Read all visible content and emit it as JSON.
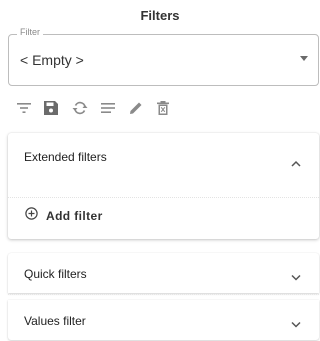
{
  "title": "Filters",
  "filter": {
    "legend": "Filter",
    "value": "< Empty >"
  },
  "toolbar": {
    "icons": [
      "filter-list-icon",
      "save-icon",
      "refresh-icon",
      "notes-icon",
      "edit-icon",
      "delete-icon"
    ]
  },
  "extended": {
    "header": "Extended filters",
    "add_filter_label": "Add filter"
  },
  "sections": [
    {
      "label": "Quick filters"
    },
    {
      "label": "Values filter"
    }
  ],
  "colors": {
    "icon": "#8a8a8a",
    "icon_dark": "#6b6b6b"
  }
}
